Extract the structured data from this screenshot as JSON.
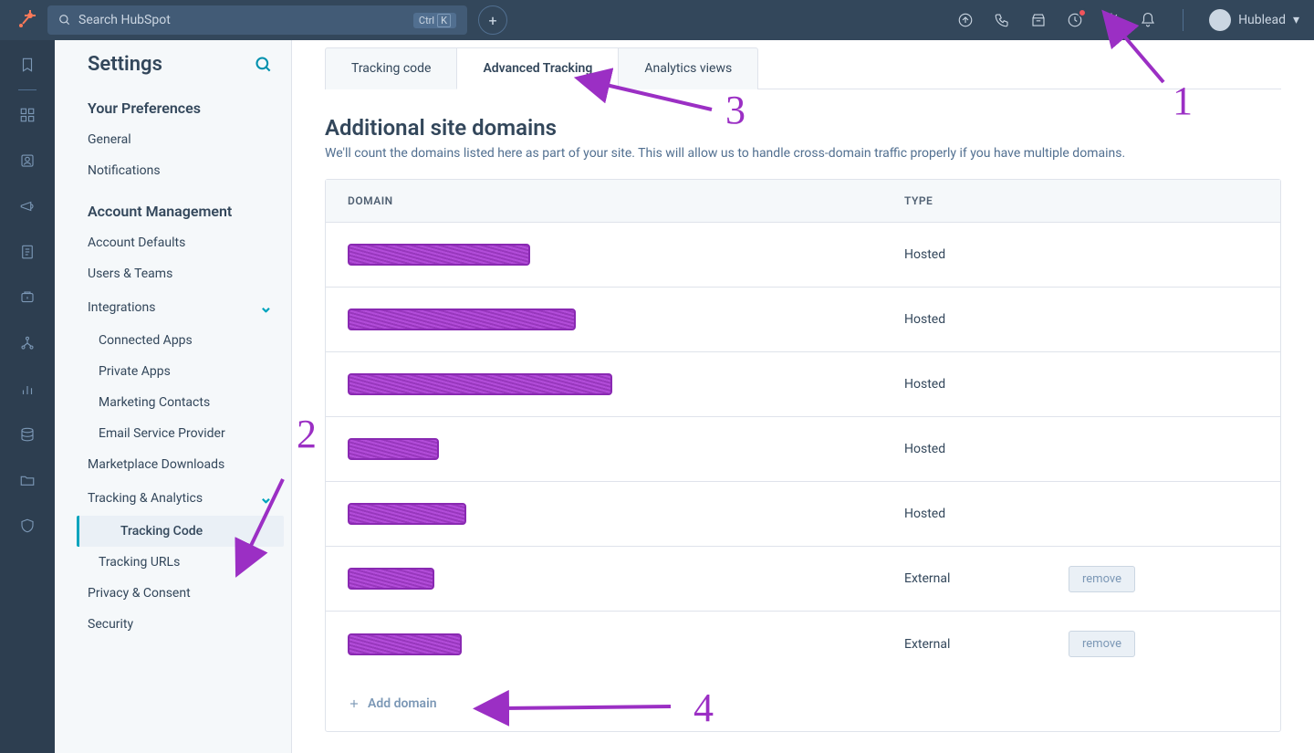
{
  "topnav": {
    "search_placeholder": "Search HubSpot",
    "shortcut1": "Ctrl",
    "shortcut2": "K",
    "user_name": "Hublead"
  },
  "sidebar": {
    "title": "Settings",
    "section1": "Your Preferences",
    "items1": [
      "General",
      "Notifications"
    ],
    "section2": "Account Management",
    "items2": [
      {
        "label": "Account Defaults"
      },
      {
        "label": "Users & Teams"
      },
      {
        "label": "Integrations",
        "expand": true
      },
      {
        "label": "Connected Apps",
        "sub": true
      },
      {
        "label": "Private Apps",
        "sub": true
      },
      {
        "label": "Marketing Contacts",
        "sub": true
      },
      {
        "label": "Email Service Provider",
        "sub": true
      },
      {
        "label": "Marketplace Downloads"
      },
      {
        "label": "Tracking & Analytics",
        "expand": true
      },
      {
        "label": "Tracking Code",
        "sub": true,
        "active": true
      },
      {
        "label": "Tracking URLs",
        "sub": true
      },
      {
        "label": "Privacy & Consent"
      },
      {
        "label": "Security"
      }
    ]
  },
  "main": {
    "tabs": [
      "Tracking code",
      "Advanced Tracking",
      "Analytics views"
    ],
    "active_tab": 1,
    "heading": "Additional site domains",
    "description": "We'll count the domains listed here as part of your site. This will allow us to handle cross-domain traffic properly if you have multiple domains.",
    "col_domain": "DOMAIN",
    "col_type": "TYPE",
    "rows": [
      {
        "domain_redact_w": 200,
        "type": "Hosted",
        "removable": false
      },
      {
        "domain_redact_w": 250,
        "type": "Hosted",
        "removable": false
      },
      {
        "domain_redact_w": 290,
        "type": "Hosted",
        "removable": false
      },
      {
        "domain_redact_w": 100,
        "type": "Hosted",
        "removable": false
      },
      {
        "domain_redact_w": 130,
        "type": "Hosted",
        "removable": false
      },
      {
        "domain_redact_w": 95,
        "type": "External",
        "removable": true
      },
      {
        "domain_redact_w": 125,
        "type": "External",
        "removable": true
      }
    ],
    "remove_label": "remove",
    "add_domain": "Add domain"
  },
  "annotations": {
    "n1": "1",
    "n2": "2",
    "n3": "3",
    "n4": "4"
  }
}
